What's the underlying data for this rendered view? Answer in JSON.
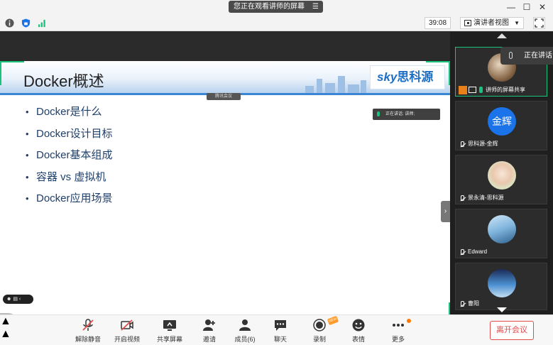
{
  "titlebar": {
    "status": "您正在观看讲师的屏幕",
    "menu_icon": "menu-icon",
    "controls": [
      "minimize-icon",
      "maximize-icon",
      "close-icon"
    ]
  },
  "toolbar": {
    "timer": "39:08",
    "view_label": "演讲者视图",
    "icons": [
      "info-icon",
      "shield-icon",
      "signal-icon",
      "grid-icon",
      "fullscreen-icon"
    ]
  },
  "slide": {
    "title": "Docker概述",
    "logo_sky": "sky",
    "logo_cn": "思科源",
    "meeting_label": "腾讯会议",
    "speaking_label": "正在讲话: 讲师;",
    "bullets": [
      "Docker是什么",
      "Docker设计目标",
      "Docker基本组成",
      "容器 vs 虚拟机",
      "Docker应用场景"
    ]
  },
  "participants": {
    "speaking_badge": "正在讲话",
    "tiles": [
      {
        "name": "讲师的屏幕共享",
        "active": true
      },
      {
        "name": "思科源-金辉",
        "avatar_text": "金辉"
      },
      {
        "name": "景永清-思科源"
      },
      {
        "name": "Edward"
      },
      {
        "name": "曹阳"
      }
    ]
  },
  "bottombar": {
    "buttons": [
      {
        "label": "解除静音",
        "icon": "mic-muted-icon"
      },
      {
        "label": "开启视频",
        "icon": "video-off-icon"
      },
      {
        "label": "共享屏幕",
        "icon": "share-screen-icon"
      },
      {
        "label": "邀请",
        "icon": "invite-icon"
      },
      {
        "label": "成员(6)",
        "icon": "members-icon"
      },
      {
        "label": "聊天",
        "icon": "chat-icon"
      },
      {
        "label": "录制",
        "icon": "record-icon"
      },
      {
        "label": "表情",
        "icon": "emoji-icon"
      },
      {
        "label": "更多",
        "icon": "more-icon"
      }
    ],
    "leave_label": "离开会议",
    "accent": "#e24b4b"
  }
}
